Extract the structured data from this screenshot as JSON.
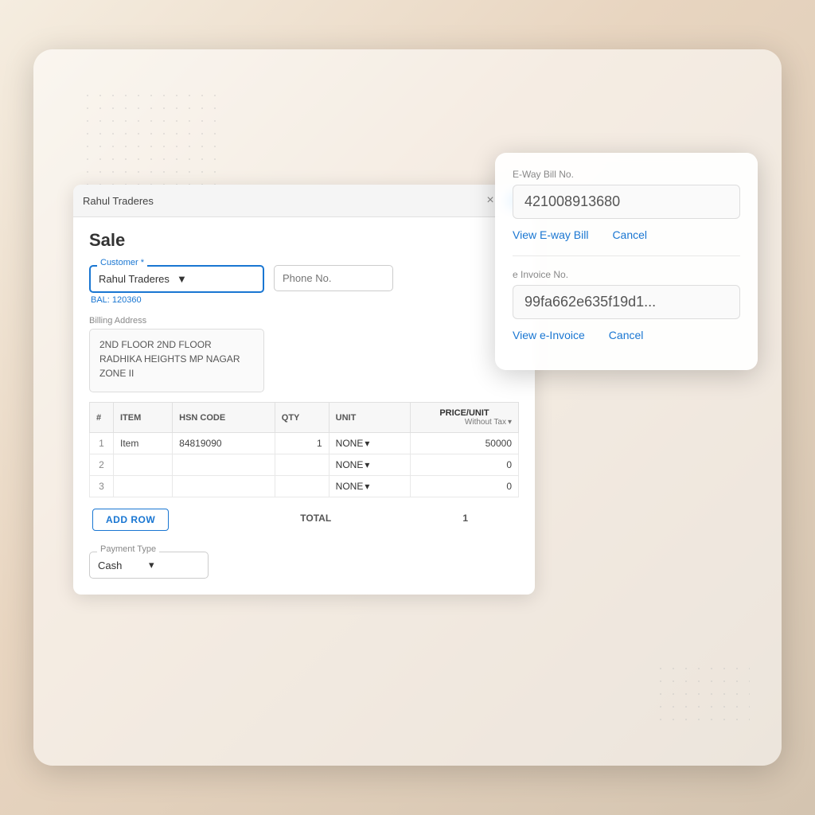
{
  "app": {
    "background": "gradient"
  },
  "window": {
    "title": "Rahul Traderes",
    "close_label": "×",
    "add_tab_label": "+"
  },
  "sale": {
    "page_title": "Sale",
    "customer": {
      "label": "Customer *",
      "value": "Rahul Traderes",
      "balance": "BAL: 120360"
    },
    "phone": {
      "placeholder": "Phone No."
    },
    "billing_address": {
      "label": "Billing Address",
      "value": "2ND FLOOR 2ND FLOOR RADHIKA HEIGHTS MP NAGAR ZONE II"
    }
  },
  "table": {
    "headers": {
      "num": "#",
      "item": "ITEM",
      "hsn_code": "HSN CODE",
      "qty": "QTY",
      "unit": "UNIT",
      "price_unit": "PRICE/UNIT",
      "price_sub": "Without Tax"
    },
    "rows": [
      {
        "num": "1",
        "item": "Item",
        "hsn_code": "84819090",
        "qty": "1",
        "unit": "NONE",
        "price": "50000"
      },
      {
        "num": "2",
        "item": "",
        "hsn_code": "",
        "qty": "",
        "unit": "NONE",
        "price": "0"
      },
      {
        "num": "3",
        "item": "",
        "hsn_code": "",
        "qty": "",
        "unit": "NONE",
        "price": "0"
      }
    ],
    "add_row_label": "ADD ROW",
    "total_label": "TOTAL",
    "total_value": "1"
  },
  "payment": {
    "label": "Payment Type",
    "value": "Cash"
  },
  "popup": {
    "eway_label": "E-Way Bill No.",
    "eway_value": "421008913680",
    "view_eway_label": "View E-way Bill",
    "cancel_eway_label": "Cancel",
    "einvoice_label": "e Invoice No.",
    "einvoice_value": "99fa662e635f19d1...",
    "view_einvoice_label": "View e-Invoice",
    "cancel_einvoice_label": "Cancel"
  },
  "bg_popup": {
    "eway_label": "E-W...",
    "eway_value": "42...",
    "view_label": "View...",
    "einvoice_label": "e In...",
    "einvoice_value": "99...",
    "view_einvoice": "View e-Invoice",
    "cancel": "Cancel"
  }
}
